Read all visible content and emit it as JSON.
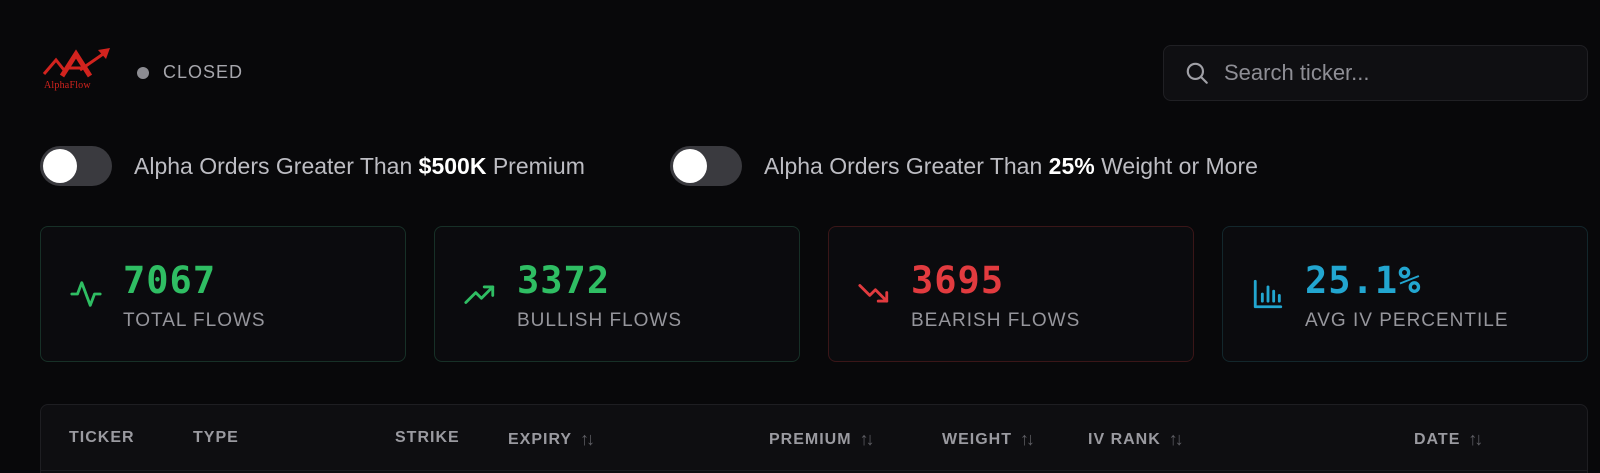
{
  "brand": {
    "name": "AlphaFlow",
    "color": "#d2231e"
  },
  "market_status": {
    "text": "CLOSED",
    "dot_color": "#8c8c92"
  },
  "search": {
    "placeholder": "Search ticker...",
    "value": "",
    "icon": "search-icon"
  },
  "filters": [
    {
      "prefix": "Alpha Orders Greater Than ",
      "highlight": "$500K",
      "suffix": " Premium",
      "enabled": false
    },
    {
      "prefix": "Alpha Orders Greater Than ",
      "highlight": "25%",
      "suffix": " Weight or More",
      "enabled": false
    }
  ],
  "stats": [
    {
      "value": "7067",
      "label": "TOTAL FLOWS",
      "icon": "activity-icon",
      "color": "#2fbe63"
    },
    {
      "value": "3372",
      "label": "BULLISH FLOWS",
      "icon": "trending-up-icon",
      "color": "#2fbe63"
    },
    {
      "value": "3695",
      "label": "BEARISH FLOWS",
      "icon": "trending-down-icon",
      "color": "#e23b3f"
    },
    {
      "value": "25.1%",
      "label": "AVG IV PERCENTILE",
      "icon": "bar-chart-icon",
      "color": "#22a6d0"
    }
  ],
  "table": {
    "columns": [
      {
        "label": "TICKER",
        "sortable": false
      },
      {
        "label": "TYPE",
        "sortable": false
      },
      {
        "label": "STRIKE",
        "sortable": false
      },
      {
        "label": "EXPIRY",
        "sortable": true
      },
      {
        "label": "PREMIUM",
        "sortable": true
      },
      {
        "label": "WEIGHT",
        "sortable": true
      },
      {
        "label": "IV RANK",
        "sortable": true
      },
      {
        "label": "DATE",
        "sortable": true
      }
    ],
    "sort_glyph": "↑↓"
  }
}
